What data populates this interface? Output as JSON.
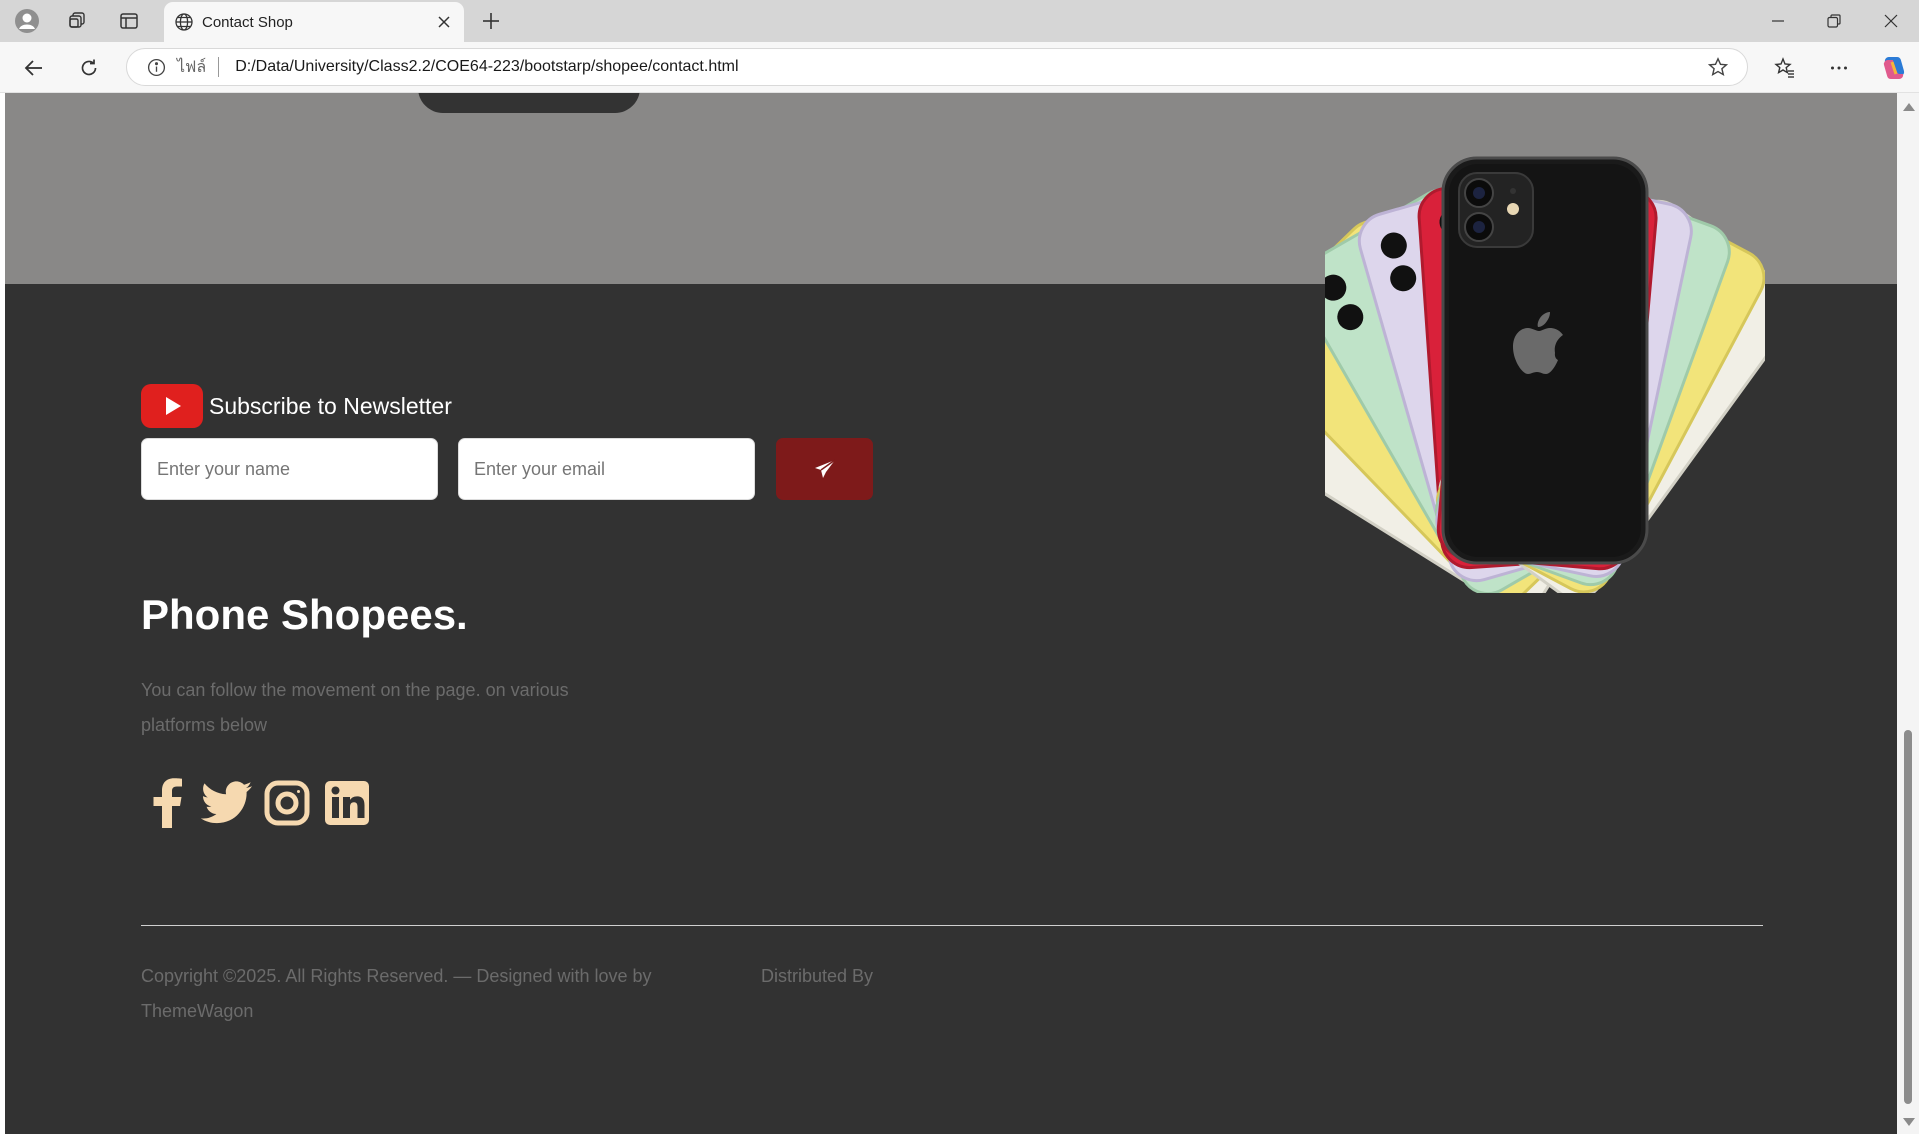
{
  "browser": {
    "tab_title": "Contact Shop",
    "address_prefix": "ไฟล์",
    "url": "D:/Data/University/Class2.2/COE64-223/bootstarp/shopee/contact.html",
    "icons": [
      "profile-icon",
      "workspaces-icon",
      "tab-actions-icon",
      "globe-icon",
      "close-icon",
      "new-tab-icon",
      "minimize-icon",
      "restore-icon",
      "close-window-icon",
      "back-icon",
      "refresh-icon",
      "info-icon",
      "star-icon",
      "favorites-icon",
      "more-icon",
      "copilot-icon"
    ]
  },
  "newsletter": {
    "title": "Subscribe to Newsletter",
    "name_placeholder": "Enter your name",
    "email_placeholder": "Enter your email",
    "send_icon": "paper-plane-icon"
  },
  "footer": {
    "brand": "Phone Shopees.",
    "description": "You can follow the movement on the page. on various platforms below",
    "social": [
      "facebook-icon",
      "twitter-icon",
      "instagram-icon",
      "linkedin-icon"
    ],
    "copyright": "Copyright ©2025. All Rights Reserved. — Designed with love by ThemeWagon",
    "distributed": "Distributed By"
  },
  "colors": {
    "dark_background": "#323232",
    "grey_band": "#898887",
    "accent_red": "#7e1a1a",
    "youtube_red": "#e0201e",
    "social_icon": "#f6d9b0"
  }
}
